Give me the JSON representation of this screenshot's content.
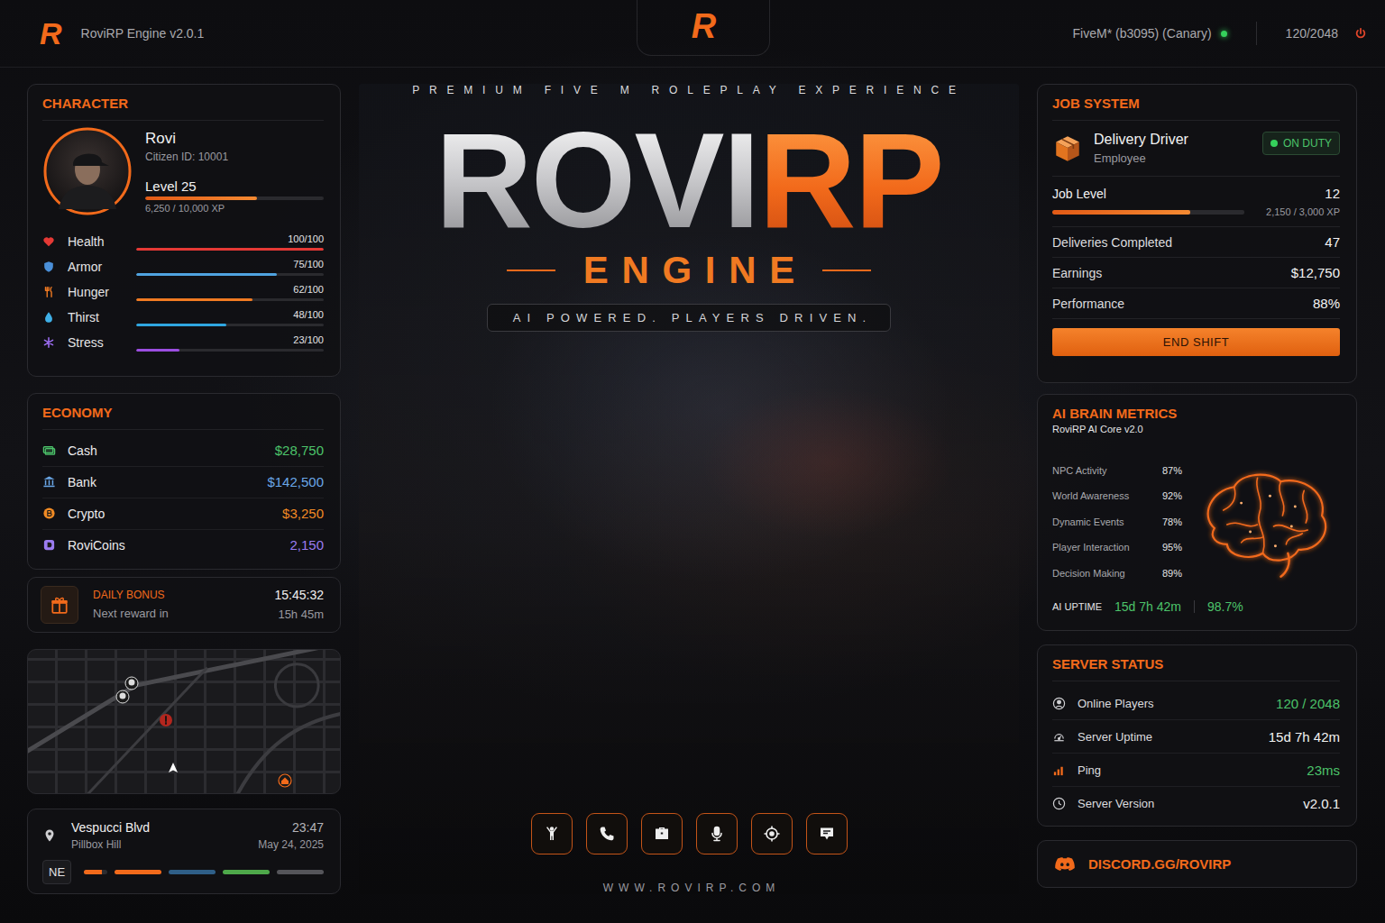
{
  "topbar": {
    "logo": "R",
    "title": "RoviRP Engine v2.0.1",
    "center_logo": "R",
    "build": "FiveM* (b3095) (Canary)",
    "online": true,
    "players": "120/2048"
  },
  "hero": {
    "tagline": "PREMIUM FIVE M ROLEPLAY EXPERIENCE",
    "title_light": "ROVI",
    "title_accent": "RP",
    "subtitle": "ENGINE",
    "motto": "AI POWERED. PLAYERS DRIVEN.",
    "website": "WWW.ROVIRP.COM",
    "hotbar": [
      {
        "kind": "emote"
      },
      {
        "kind": "phone"
      },
      {
        "kind": "inventory"
      },
      {
        "kind": "voice"
      },
      {
        "kind": "gps"
      },
      {
        "kind": "map"
      }
    ]
  },
  "character": {
    "title": "CHARACTER",
    "name": "Rovi",
    "citizen_id": "Citizen ID: 10001",
    "level": "Level 25",
    "xp": "6,250 / 10,000 XP",
    "xp_level": 0.625,
    "stats": [
      {
        "kind": "health",
        "label": "Health",
        "reading": "100/100",
        "level": 1.0,
        "color": "#e53935"
      },
      {
        "kind": "armor",
        "label": "Armor",
        "reading": "75/100",
        "level": 0.75,
        "color": "#4fa3e0"
      },
      {
        "kind": "hunger",
        "label": "Hunger",
        "reading": "62/100",
        "level": 0.62,
        "color": "#f07a22"
      },
      {
        "kind": "thirst",
        "label": "Thirst",
        "reading": "48/100",
        "level": 0.48,
        "color": "#2fa6e0"
      },
      {
        "kind": "stress",
        "label": "Stress",
        "reading": "23/100",
        "level": 0.23,
        "color": "#9b4de0"
      }
    ]
  },
  "economy": {
    "title": "ECONOMY",
    "items": [
      {
        "kind": "cash",
        "label": "Cash",
        "value": "$28,750",
        "color": "#4cc36a"
      },
      {
        "kind": "bank",
        "label": "Bank",
        "value": "$142,500",
        "color": "#6aa7e8"
      },
      {
        "kind": "crypto",
        "label": "Crypto",
        "value": "$3,250",
        "color": "#f08a24"
      },
      {
        "kind": "coin",
        "label": "RoviCoins",
        "value": "2,150",
        "color": "#9b7cf0"
      }
    ]
  },
  "daily_bonus": {
    "title": "DAILY BONUS",
    "caption": "Next reward in",
    "timer": "15:45:32",
    "remaining": "15h 45m"
  },
  "location": {
    "street": "Vespucci Blvd",
    "area": "Pillbox Hill",
    "time": "23:47",
    "date": "May 24, 2025",
    "heading": "NE",
    "bars": [
      {
        "level": 0.75,
        "color": "#f26a1b"
      },
      {
        "level": 1.0,
        "color": "#f26a1b"
      },
      {
        "level": 1.0,
        "color": "#2f5f88"
      },
      {
        "level": 1.0,
        "color": "#4ea84a"
      },
      {
        "level": 1.0,
        "color": "#55555a"
      }
    ]
  },
  "job": {
    "title": "JOB SYSTEM",
    "name": "Delivery Driver",
    "rank": "Employee",
    "status": "ON DUTY",
    "on_duty": true,
    "level_label": "Job Level",
    "level_value": "12",
    "xp": "2,150 / 3,000 XP",
    "xp_level": 0.717,
    "rows": [
      {
        "label": "Deliveries Completed",
        "value": "47"
      },
      {
        "label": "Earnings",
        "value": "$12,750"
      },
      {
        "label": "Performance",
        "value": "88%"
      }
    ],
    "button": "END SHIFT"
  },
  "ai": {
    "title": "AI BRAIN METRICS",
    "subtitle": "RoviRP AI Core v2.0",
    "metrics": [
      {
        "label": "NPC Activity",
        "value": "87%"
      },
      {
        "label": "World Awareness",
        "value": "92%"
      },
      {
        "label": "Dynamic Events",
        "value": "78%"
      },
      {
        "label": "Player Interaction",
        "value": "95%"
      },
      {
        "label": "Decision Making",
        "value": "89%"
      }
    ],
    "uptime_label": "AI UPTIME",
    "uptime": "15d 7h 42m",
    "availability": "98.7%"
  },
  "server": {
    "title": "SERVER STATUS",
    "rows": [
      {
        "kind": "players",
        "label": "Online Players",
        "value": "120 / 2048",
        "color": "#4cc36a"
      },
      {
        "kind": "uptime",
        "label": "Server Uptime",
        "value": "15d 7h 42m",
        "color": "#f2f2f2"
      },
      {
        "kind": "ping",
        "label": "Ping",
        "value": "23ms",
        "color": "#4cc36a"
      },
      {
        "kind": "version",
        "label": "Server Version",
        "value": "v2.0.1",
        "color": "#f2f2f2"
      }
    ]
  },
  "discord": {
    "label": "DISCORD.GG/ROVIRP"
  }
}
